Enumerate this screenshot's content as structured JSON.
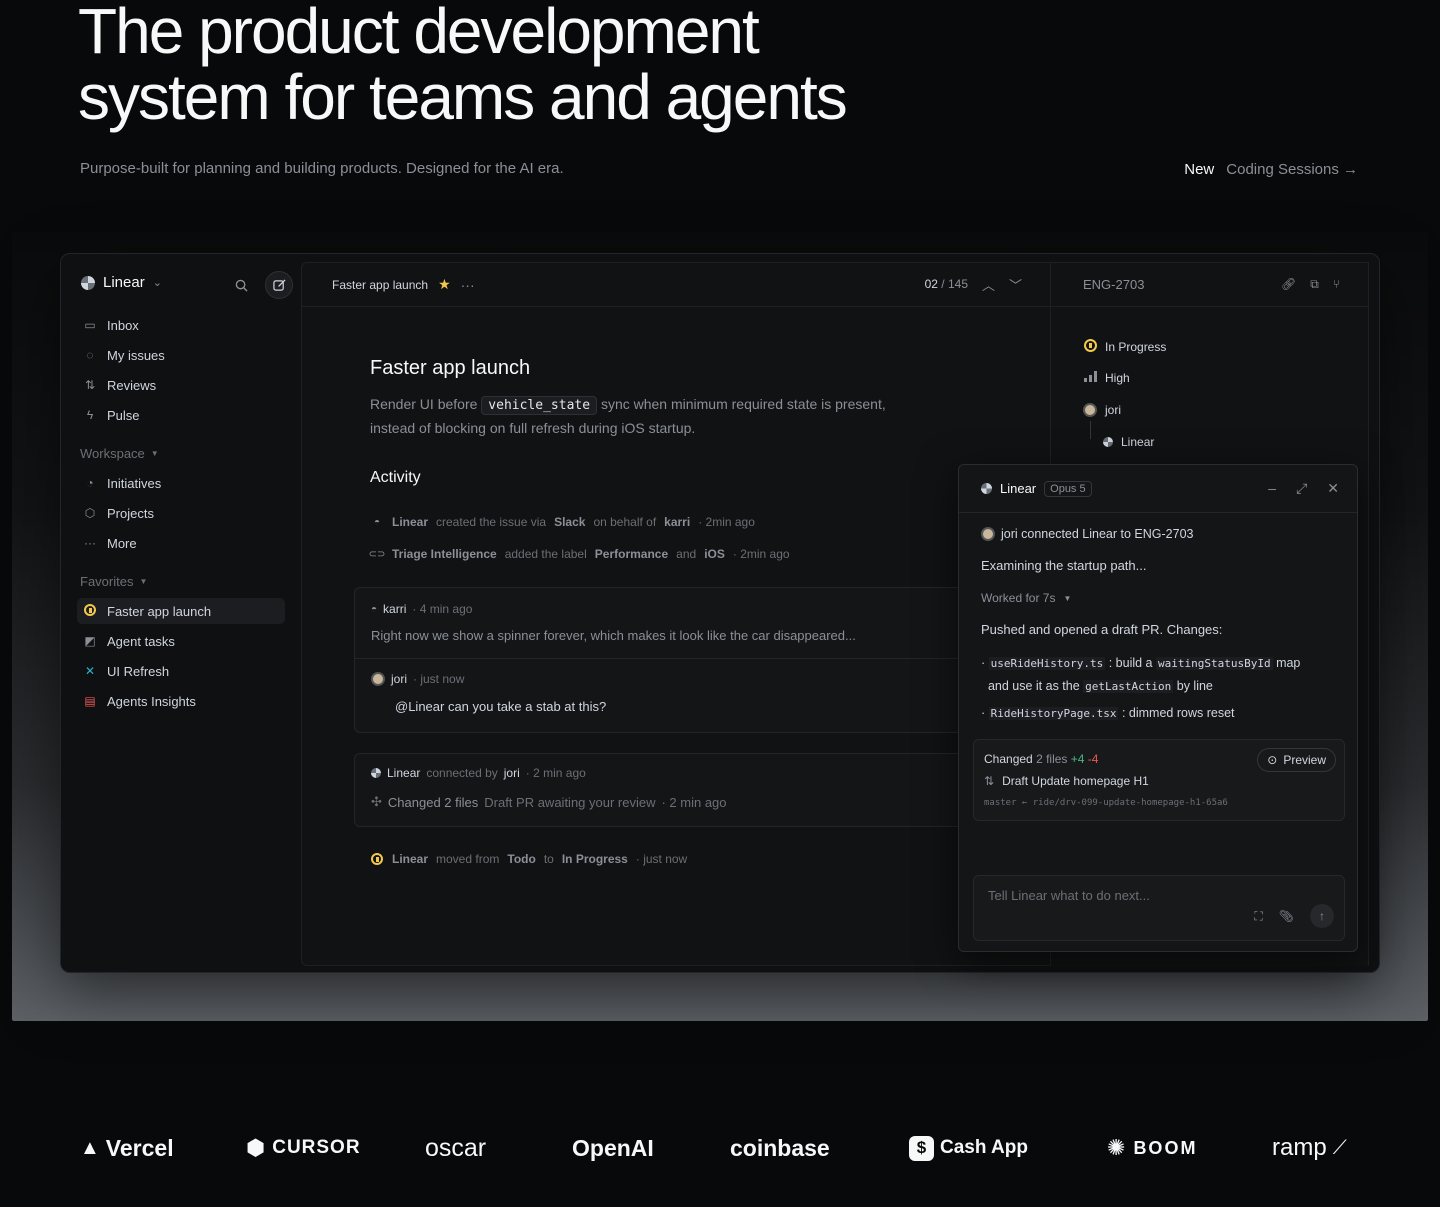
{
  "hero": {
    "title_line1": "The product development",
    "title_line2": "system for teams and agents",
    "subtitle": "Purpose-built for planning and building products. Designed for the AI era.",
    "new_label": "New",
    "link_label": "Coding Sessions →"
  },
  "sidebar": {
    "workspace": "Linear",
    "items": [
      {
        "icon": "inbox-icon",
        "label": "Inbox"
      },
      {
        "icon": "my-issues-icon",
        "label": "My issues"
      },
      {
        "icon": "reviews-icon",
        "label": "Reviews"
      },
      {
        "icon": "pulse-icon",
        "label": "Pulse"
      }
    ],
    "workspace_label": "Workspace",
    "workspace_items": [
      {
        "icon": "initiatives-icon",
        "label": "Initiatives"
      },
      {
        "icon": "projects-icon",
        "label": "Projects"
      },
      {
        "icon": "more-icon",
        "label": "More"
      }
    ],
    "favorites_label": "Favorites",
    "favorites": [
      {
        "icon": "in-progress-icon",
        "label": "Faster app launch"
      },
      {
        "icon": "agent-tasks-icon",
        "label": "Agent tasks"
      },
      {
        "icon": "ui-refresh-icon",
        "label": "UI Refresh"
      },
      {
        "icon": "agents-insights-icon",
        "label": "Agents Insights"
      }
    ]
  },
  "main": {
    "breadcrumb": "Faster app launch",
    "pager_current": "02",
    "pager_sep": "/",
    "pager_total": "145",
    "title": "Faster app launch",
    "desc_before": "Render UI before",
    "desc_code": "vehicle_state",
    "desc_after": "sync when minimum required state is present,",
    "desc_line2": "instead of blocking on full refresh during iOS startup.",
    "activity_heading": "Activity",
    "act1": {
      "actor": "Linear",
      "t1": "created the issue via",
      "via": "Slack",
      "t2": "on behalf of",
      "user": "karri",
      "time": "· 2min ago"
    },
    "act2": {
      "actor": "Triage Intelligence",
      "t1": "added the label",
      "label1": "Performance",
      "t2": "and",
      "label2": "iOS",
      "time": "· 2min ago"
    },
    "comment1": {
      "author": "karri",
      "time": "· 4 min ago",
      "body": "Right now we show a spinner forever, which makes it look like the car disappeared..."
    },
    "comment2": {
      "author": "jori",
      "time": "· just now",
      "body": "@Linear can you take a stab at this?"
    },
    "agent_card": {
      "actor": "Linear",
      "t1": "connected by",
      "user": "jori",
      "time": "· 2 min ago",
      "changed": "Changed 2 files",
      "pr": "Draft PR awaiting your review",
      "pr_time": "· 2 min ago"
    },
    "act3": {
      "actor": "Linear",
      "t1": "moved from",
      "from": "Todo",
      "t2": "to",
      "to": "In Progress",
      "time": "· just now"
    }
  },
  "details": {
    "issue_id": "ENG-2703",
    "status": "In Progress",
    "priority": "High",
    "assignee": "jori",
    "agent": "Linear"
  },
  "agent_panel": {
    "name": "Linear",
    "model": "Opus 5",
    "connected": "jori connected Linear to ENG-2703",
    "examining": "Examining the startup path...",
    "worked": "Worked for 7s",
    "pushed": "Pushed and opened a draft PR. Changes:",
    "b1_file": "useRideHistory.ts",
    "b1_t1": ": build a",
    "b1_code": "waitingStatusById",
    "b1_t2": "map",
    "b1_t3": "and use it as the",
    "b1_code2": "getLastAction",
    "b1_t4": "by line",
    "b2_file": "RideHistoryPage.tsx",
    "b2_t1": ": dimmed rows reset",
    "changed_label": "Changed",
    "files": "2 files",
    "added": "+4",
    "removed": "-4",
    "preview": "Preview",
    "pr_title": "Draft Update homepage H1",
    "branch": "master ← ride/drv-099-update-homepage-h1-65a6",
    "input_placeholder": "Tell Linear what to do next..."
  },
  "logos": [
    "Vercel",
    "CURSOR",
    "oscar",
    "OpenAI",
    "coinbase",
    "Cash App",
    "BOOM",
    "ramp"
  ]
}
